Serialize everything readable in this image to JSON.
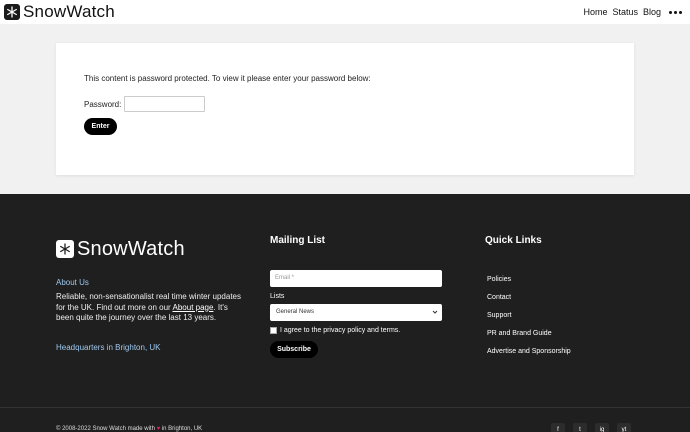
{
  "header": {
    "brand": "SnowWatch",
    "nav": [
      "Home",
      "Status",
      "Blog"
    ]
  },
  "main": {
    "prompt": "This content is password protected. To view it please enter your password below:",
    "password_label": "Password:",
    "password_value": "",
    "enter_label": "Enter"
  },
  "footer": {
    "brand": "SnowWatch",
    "about_title": "About Us",
    "about_text_before": "Reliable, non-sensationalist real time winter updates for the UK. Find out more on our ",
    "about_link": "About page",
    "about_text_after": ". It's been quite the journey over the last 13 years.",
    "hq": "Headquarters in Brighton, UK",
    "mailing_title": "Mailing List",
    "email_placeholder": "Email *",
    "lists_label": "Lists",
    "lists_selected": "General News",
    "agree_text": "I agree to the privacy policy and terms.",
    "subscribe_label": "Subscribe",
    "quick_title": "Quick Links",
    "quick_links": [
      "Policies",
      "Contact",
      "Support",
      "PR and Brand Guide",
      "Advertise and Sponsorship"
    ],
    "copyright_before": "© 2008-2022 Snow Watch made with ",
    "copyright_after": " in Brighton, UK",
    "social": [
      "f",
      "t",
      "ig",
      "yt"
    ]
  },
  "colors": {
    "footer_bg": "#1f1f1f",
    "accent_link": "#9ec9ef",
    "button": "#000000"
  }
}
